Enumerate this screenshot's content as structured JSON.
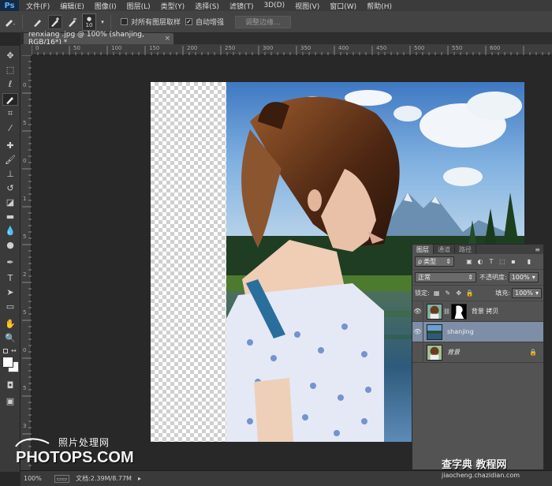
{
  "app": {
    "logo": "Ps"
  },
  "menu": [
    "文件(F)",
    "编辑(E)",
    "图像(I)",
    "图层(L)",
    "类型(Y)",
    "选择(S)",
    "滤镜(T)",
    "3D(D)",
    "视图(V)",
    "窗口(W)",
    "帮助(H)"
  ],
  "options": {
    "brush_size": "10",
    "sample_all_layers": "对所有图层取样",
    "auto_enhance": "自动增强",
    "refine_edge": "调整边缘..."
  },
  "document": {
    "tab_title": "renxiang .jpg @ 100% (shanjing, RGB/16*) *",
    "zoom": "100%",
    "doc_info": "文档:2.39M/8.77M"
  },
  "ruler_top": [
    "0",
    "50",
    "100",
    "150",
    "200",
    "250",
    "300",
    "350",
    "400",
    "450",
    "500",
    "550",
    "600"
  ],
  "ruler_left": [
    "0",
    "5",
    "0",
    "1",
    "5",
    "2",
    "5",
    "0",
    "5",
    "3"
  ],
  "layers_panel": {
    "tabs": [
      "图层",
      "通道",
      "路径"
    ],
    "filter_kind": "类型",
    "blend_mode": "正常",
    "opacity_label": "不透明度:",
    "opacity_value": "100%",
    "lock_label": "锁定:",
    "fill_label": "填充:",
    "fill_value": "100%",
    "layers": [
      {
        "name": "背景 拷贝",
        "visible": true,
        "selected": false,
        "has_mask": true
      },
      {
        "name": "shanjing",
        "visible": true,
        "selected": true,
        "has_mask": false
      },
      {
        "name": "背景",
        "visible": false,
        "selected": false,
        "locked": true
      }
    ]
  },
  "watermark": {
    "cn": "照片处理网",
    "en": "PHOTOPS.COM"
  },
  "stamp": {
    "main": "查字典 教程网",
    "sub": "jiaocheng.chazidian.com"
  }
}
